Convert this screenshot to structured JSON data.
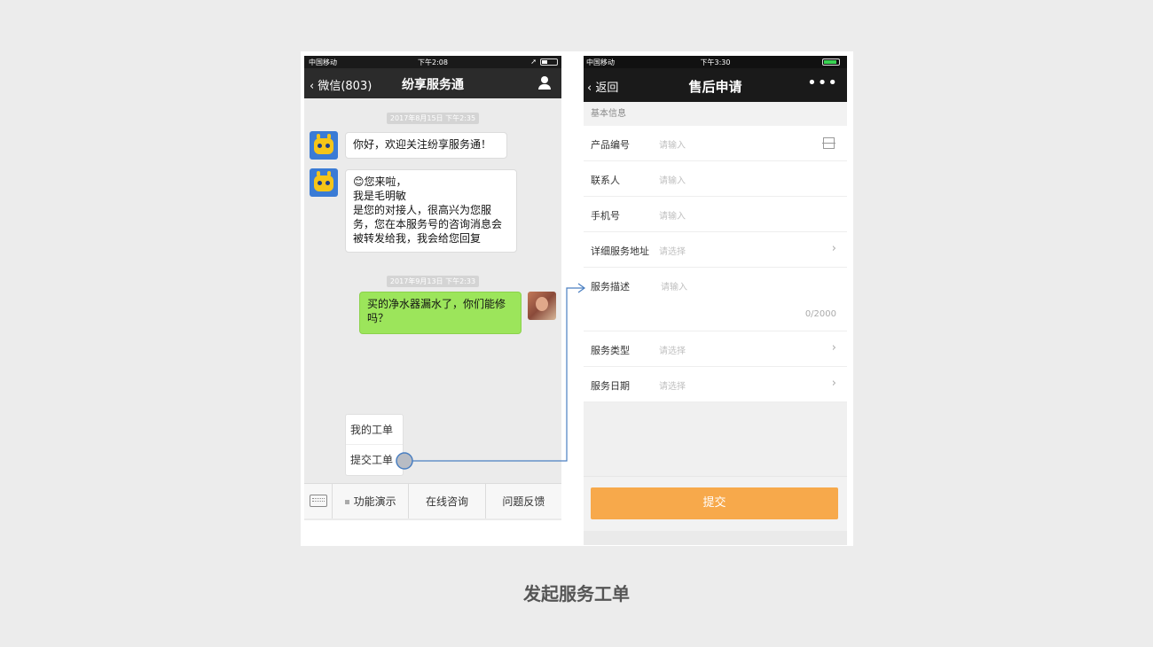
{
  "left_phone": {
    "status": {
      "carrier": "中国移动",
      "time": "下午2:08"
    },
    "nav": {
      "back_label": "微信(803)",
      "title": "纷享服务通"
    },
    "timestamps": [
      "2017年8月15日 下午2:35",
      "2017年9月13日 下午2:33"
    ],
    "messages": [
      {
        "from": "bot",
        "text": "你好，欢迎关注纷享服务通！"
      },
      {
        "from": "bot",
        "lines": [
          "😊您来啦，",
          "我是毛明敏",
          "是您的对接人，很高兴为您服",
          "务，您在本服务号的咨询消息会",
          "被转发给我，我会给您回复"
        ]
      },
      {
        "from": "user",
        "lines": [
          "买的净水器漏水了，你们能修",
          "吗？"
        ]
      }
    ],
    "popup_menu": [
      "我的工单",
      "提交工单"
    ],
    "bottom_menu": [
      "功能演示",
      "在线咨询",
      "问题反馈"
    ]
  },
  "right_phone": {
    "status": {
      "carrier": "中国移动",
      "time": "下午3:30"
    },
    "nav": {
      "back_label": "返回",
      "title": "售后申请",
      "more_icon": "•••"
    },
    "section_title": "基本信息",
    "fields": [
      {
        "label": "产品编号",
        "placeholder": "请输入",
        "accessory": "scan-icon"
      },
      {
        "label": "联系人",
        "placeholder": "请输入"
      },
      {
        "label": "手机号",
        "placeholder": "请输入"
      },
      {
        "label": "详细服务地址",
        "placeholder": "请选择",
        "accessory": "chevron-right-icon"
      },
      {
        "label": "服务描述",
        "placeholder": "请输入",
        "counter": "0/2000"
      },
      {
        "label": "服务类型",
        "placeholder": "请选择",
        "accessory": "chevron-right-icon"
      },
      {
        "label": "服务日期",
        "placeholder": "请选择",
        "accessory": "chevron-right-icon"
      }
    ],
    "submit_label": "提交"
  },
  "caption": "发起服务工单",
  "colors": {
    "accent_orange": "#f7a94b",
    "chat_green": "#9ce55b",
    "connector_blue": "#4a7fc1"
  }
}
